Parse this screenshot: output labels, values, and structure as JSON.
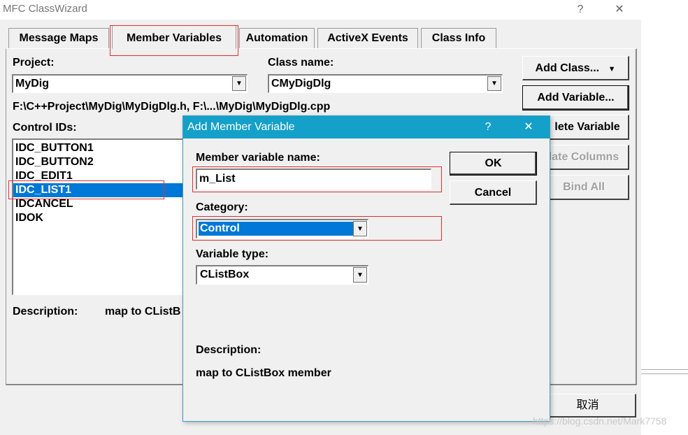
{
  "outer": {
    "title": "MFC ClassWizard",
    "help": "?",
    "close": "✕",
    "tabs": [
      "Message Maps",
      "Member Variables",
      "Automation",
      "ActiveX Events",
      "Class Info"
    ],
    "project_label": "Project:",
    "project_value": "MyDig",
    "class_label": "Class name:",
    "class_value": "CMyDigDlg",
    "path": "F:\\C++Project\\MyDig\\MyDigDlg.h, F:\\...\\MyDig\\MyDigDlg.cpp",
    "control_ids_label": "Control IDs:",
    "control_ids": [
      "IDC_BUTTON1",
      "IDC_BUTTON2",
      "IDC_EDIT1",
      "IDC_LIST1",
      "IDCANCEL",
      "IDOK"
    ],
    "selected_id": "IDC_LIST1",
    "buttons": {
      "add_class": "Add Class...",
      "add_variable": "Add Variable...",
      "delete_variable": "lete Variable",
      "update_columns": "late Columns",
      "bind_all": "Bind All"
    },
    "description_label": "Description:",
    "description_value": "map to CListB",
    "cancel": "取消"
  },
  "dialog": {
    "title": "Add Member Variable",
    "help": "?",
    "close": "✕",
    "name_label": "Member variable name:",
    "name_value": "m_List",
    "category_label": "Category:",
    "category_value": "Control",
    "type_label": "Variable type:",
    "type_value": "CListBox",
    "ok": "OK",
    "cancel": "Cancel",
    "description_label": "Description:",
    "description_value": "map to CListBox member"
  },
  "watermark": "https://blog.csdn.net/Mark7758",
  "colors": {
    "selection": "#0078d7",
    "title_bar": "#14a0c8",
    "highlight_box": "#e03030"
  }
}
